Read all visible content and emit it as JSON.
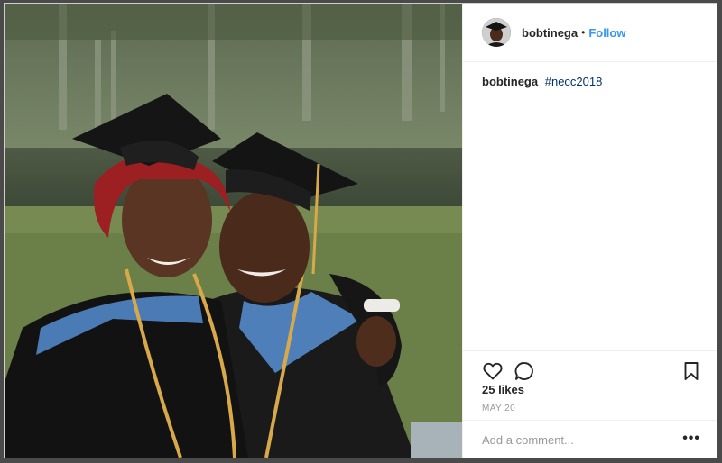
{
  "post": {
    "image_alt": "Two graduates in black caps and gowns smiling outdoors",
    "user": {
      "username": "bobtinega",
      "follow_label": "Follow",
      "separator": "•"
    },
    "caption": {
      "username": "bobtinega",
      "hashtag": "#necc2018"
    },
    "actions": {
      "like_icon": "heart-outline-icon",
      "comment_icon": "speech-bubble-icon",
      "save_icon": "bookmark-icon"
    },
    "likes": "25 likes",
    "date": "MAY 20",
    "comment": {
      "placeholder": "Add a comment...",
      "more_label": "•••"
    }
  },
  "colors": {
    "link_blue": "#3897f0",
    "hashtag_blue": "#003569",
    "text": "#262626",
    "muted": "#999999",
    "divider": "#efefef"
  }
}
